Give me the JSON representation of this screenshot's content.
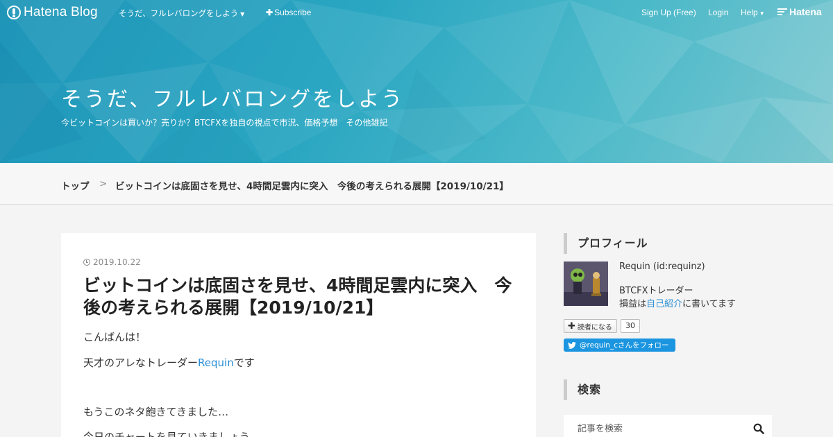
{
  "topbar": {
    "logo_text": "Hatena Blog",
    "blog_menu": "そうだ、フルレバロングをしよう",
    "subscribe": "Subscribe",
    "signup": "Sign Up (Free)",
    "login": "Login",
    "help": "Help",
    "hatena": "Hatena"
  },
  "header": {
    "title": "そうだ、フルレバロングをしよう",
    "description": "今ビットコインは買いか？売りか？BTCFXを独自の視点で市況、価格予想　その他雑記"
  },
  "breadcrumb": {
    "top": "トップ",
    "separator": ">",
    "current": "ビットコインは底固さを見せ、4時間足雲内に突入　今後の考えられる展開【2019/10/21】"
  },
  "entry": {
    "date": "2019.10.22",
    "title": "ビットコインは底固さを見せ、4時間足雲内に突入　今後の考えられる展開【2019/10/21】",
    "p1": "こんばんは！",
    "p2_before": "天才のアレなトレーダー",
    "p2_link": "Requin",
    "p2_after": "です",
    "p3": "もうこのネタ飽きてきました…",
    "p4": "今日のチャートを見ていきましょう"
  },
  "sidebar": {
    "profile_heading": "プロフィール",
    "profile_name": "Requin (id:requinz)",
    "profile_line1": "BTCFXトレーダー",
    "profile_line2_before": "損益は",
    "profile_line2_link": "自己紹介",
    "profile_line2_after": "に書いてます",
    "reader_button": "読者になる",
    "reader_count": "30",
    "twitter_follow": "@requin_cさんをフォロー",
    "search_heading": "検索",
    "search_placeholder": "記事を検索"
  },
  "colors": {
    "banner": "#2aa6c2",
    "link": "#2a8fd6",
    "twitter": "#1b95e0"
  }
}
